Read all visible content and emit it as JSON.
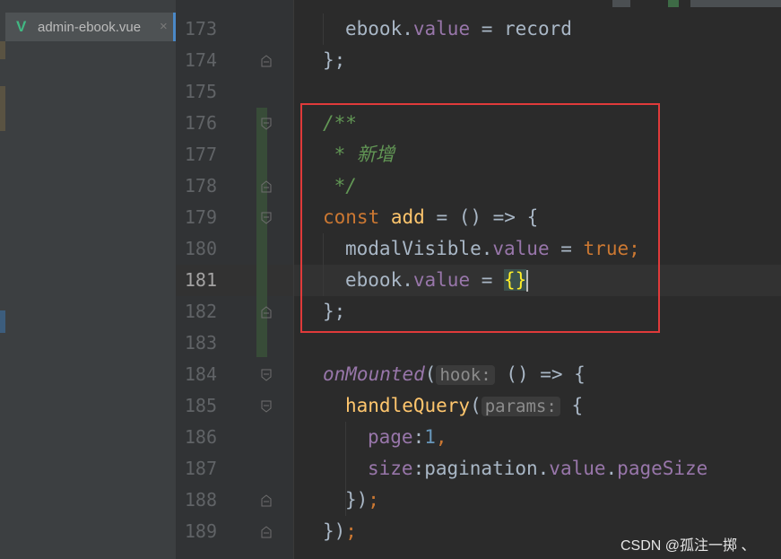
{
  "tab": {
    "icon": "vue-icon",
    "label": "admin-ebook.vue",
    "close": "×"
  },
  "lines": [
    {
      "n": "173",
      "code": [
        {
          "t": "ebook",
          "c": "plain"
        },
        {
          "t": ".",
          "c": "plain"
        },
        {
          "t": "value",
          "c": "prop"
        },
        {
          "t": " = record",
          "c": "plain"
        }
      ],
      "indent": 1
    },
    {
      "n": "174",
      "code": [
        {
          "t": "};",
          "c": "plain"
        }
      ],
      "indent": 0
    },
    {
      "n": "175",
      "code": [],
      "indent": 0
    },
    {
      "n": "176",
      "code": [
        {
          "t": "/**",
          "c": "comment"
        }
      ],
      "indent": 0
    },
    {
      "n": "177",
      "code": [
        {
          "t": " * 新增",
          "c": "comment"
        }
      ],
      "indent": 0
    },
    {
      "n": "178",
      "code": [
        {
          "t": " */",
          "c": "comment"
        }
      ],
      "indent": 0
    },
    {
      "n": "179",
      "code": [
        {
          "t": "const ",
          "c": "kw"
        },
        {
          "t": "add",
          "c": "fn"
        },
        {
          "t": " = () => {",
          "c": "plain"
        }
      ],
      "indent": 0
    },
    {
      "n": "180",
      "code": [
        {
          "t": "modalVisible",
          "c": "plain"
        },
        {
          "t": ".",
          "c": "plain"
        },
        {
          "t": "value",
          "c": "prop"
        },
        {
          "t": " = ",
          "c": "plain"
        },
        {
          "t": "true",
          "c": "kw"
        },
        {
          "t": ";",
          "c": "kw"
        }
      ],
      "indent": 1
    },
    {
      "n": "181",
      "code": [
        {
          "t": "ebook",
          "c": "plain"
        },
        {
          "t": ".",
          "c": "plain"
        },
        {
          "t": "value",
          "c": "prop"
        },
        {
          "t": " = ",
          "c": "plain"
        },
        {
          "t": "{}",
          "c": "brace-hl"
        },
        {
          "t": "",
          "c": "cursor"
        }
      ],
      "indent": 1,
      "active": true
    },
    {
      "n": "182",
      "code": [
        {
          "t": "};",
          "c": "plain"
        }
      ],
      "indent": 0
    },
    {
      "n": "183",
      "code": [],
      "indent": 0
    },
    {
      "n": "184",
      "code": [
        {
          "t": "onMounted",
          "c": "italicfn"
        },
        {
          "t": "(",
          "c": "plain"
        },
        {
          "t": "hook:",
          "c": "hint"
        },
        {
          "t": " () => {",
          "c": "plain"
        }
      ],
      "indent": 0
    },
    {
      "n": "185",
      "code": [
        {
          "t": "handleQuery",
          "c": "fn"
        },
        {
          "t": "(",
          "c": "plain"
        },
        {
          "t": "params:",
          "c": "hint"
        },
        {
          "t": " {",
          "c": "plain"
        }
      ],
      "indent": 1
    },
    {
      "n": "186",
      "code": [
        {
          "t": "page",
          "c": "prop"
        },
        {
          "t": ":",
          "c": "plain"
        },
        {
          "t": "1",
          "c": "num"
        },
        {
          "t": ",",
          "c": "kw"
        }
      ],
      "indent": 2
    },
    {
      "n": "187",
      "code": [
        {
          "t": "size",
          "c": "prop"
        },
        {
          "t": ":pagination.",
          "c": "plain"
        },
        {
          "t": "value",
          "c": "prop"
        },
        {
          "t": ".",
          "c": "plain"
        },
        {
          "t": "pageSize",
          "c": "prop"
        }
      ],
      "indent": 2
    },
    {
      "n": "188",
      "code": [
        {
          "t": "})",
          "c": "plain"
        },
        {
          "t": ";",
          "c": "kw"
        }
      ],
      "indent": 1
    },
    {
      "n": "189",
      "code": [
        {
          "t": "})",
          "c": "plain"
        },
        {
          "t": ";",
          "c": "kw"
        }
      ],
      "indent": 0
    }
  ],
  "folds": {
    "174": "end",
    "176": "start",
    "178": "end",
    "179": "start",
    "182": "end",
    "184": "start",
    "185": "start",
    "188": "end",
    "189": "end"
  },
  "watermark": "CSDN @孤注一掷 、"
}
